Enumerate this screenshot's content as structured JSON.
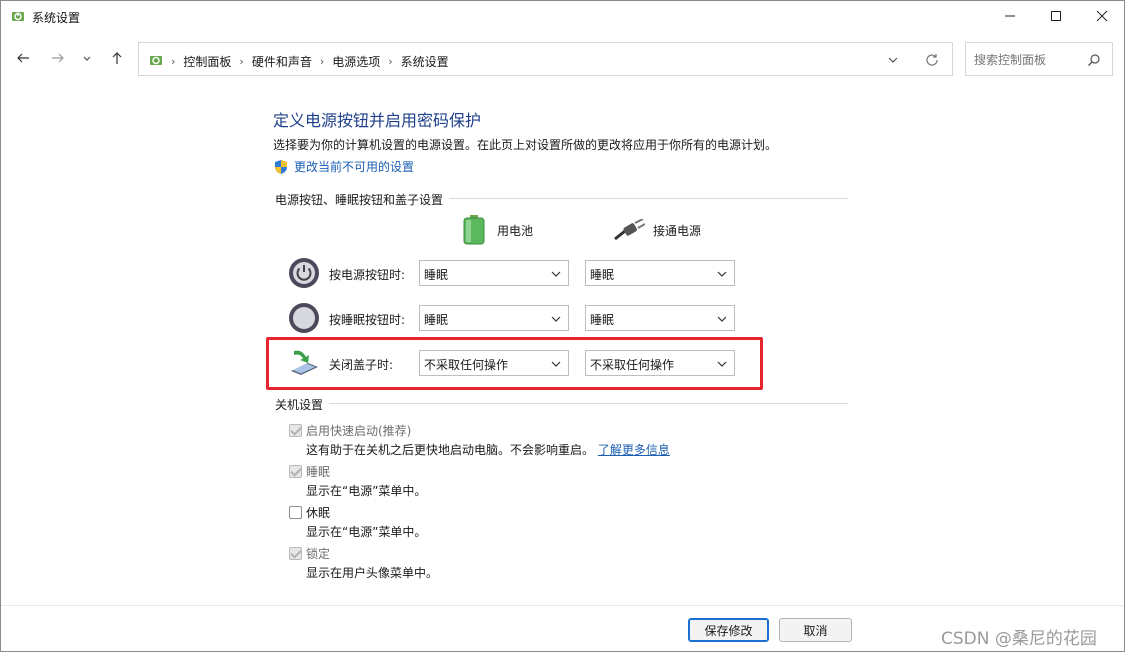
{
  "window": {
    "title": "系统设置",
    "app_icon": "power-options-icon",
    "controls": [
      "minimize-icon",
      "maximize-icon",
      "close-icon"
    ]
  },
  "navigation": {
    "breadcrumbs": [
      "控制面板",
      "硬件和声音",
      "电源选项",
      "系统设置"
    ],
    "search_placeholder": "搜索控制面板"
  },
  "page": {
    "heading": "定义电源按钮并启用密码保护",
    "description": "选择要为你的计算机设置的电源设置。在此页上对设置所做的更改将应用于你所有的电源计划。",
    "change_link": "更改当前不可用的设置"
  },
  "power_buttons": {
    "section_title": "电源按钮、睡眠按钮和盖子设置",
    "columns": {
      "battery": "用电池",
      "plugged_in": "接通电源"
    },
    "rows": [
      {
        "label": "按电源按钮时:",
        "battery": "睡眠",
        "plugged_in": "睡眠",
        "icon": "power-button-icon"
      },
      {
        "label": "按睡眠按钮时:",
        "battery": "睡眠",
        "plugged_in": "睡眠",
        "icon": "sleep-button-icon"
      },
      {
        "label": "关闭盖子时:",
        "battery": "不采取任何操作",
        "plugged_in": "不采取任何操作",
        "icon": "laptop-lid-icon"
      }
    ]
  },
  "shutdown": {
    "section_title": "关机设置",
    "options": [
      {
        "label": "启用快速启动(推荐)",
        "checked": true,
        "enabled": false,
        "desc": "这有助于在关机之后更快地启动电脑。不会影响重启。",
        "link": "了解更多信息"
      },
      {
        "label": "睡眠",
        "checked": true,
        "enabled": false,
        "desc": "显示在“电源”菜单中。"
      },
      {
        "label": "休眠",
        "checked": false,
        "enabled": true,
        "desc": "显示在“电源”菜单中。"
      },
      {
        "label": "锁定",
        "checked": true,
        "enabled": false,
        "desc": "显示在用户头像菜单中。"
      }
    ]
  },
  "footer": {
    "save": "保存修改",
    "cancel": "取消"
  },
  "watermark": "CSDN @桑尼的花园",
  "colors": {
    "heading": "#1e3f8a",
    "link": "#1a5fb4",
    "highlight": "#e5242e",
    "primary_border": "#1a6fd0"
  }
}
